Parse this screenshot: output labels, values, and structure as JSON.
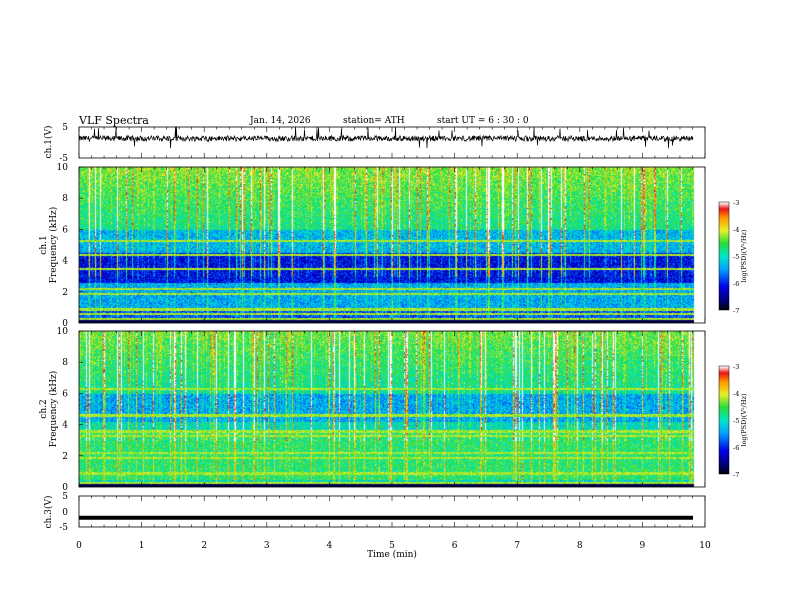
{
  "header": {
    "title": "VLF  Spectra",
    "date": "Jan. 14, 2026",
    "station": "station= ATH",
    "start_ut": "start  UT  =   6  : 30 : 0"
  },
  "chart_data": [
    {
      "type": "line",
      "panel": "ch1-waveform",
      "ylabel": "ch.1(V)",
      "ylim": [
        -5,
        5
      ],
      "yticks": [
        "5",
        "-5"
      ],
      "xlim": [
        0,
        10
      ],
      "baseline_v": 1.3
    },
    {
      "type": "heatmap",
      "panel": "ch1-spectrogram",
      "ylabel": "Frequency  (kHz)",
      "ylabel2": "ch.1",
      "ylim": [
        0,
        10
      ],
      "yticks": [
        "0",
        "2",
        "4",
        "6",
        "8",
        "10"
      ],
      "xlim": [
        0,
        10
      ],
      "colorbar": {
        "label": "log(PSD)(V²/Hz)",
        "range": [
          -7,
          -3
        ],
        "ticks": [
          "-3",
          "-4",
          "-5",
          "-6",
          "-7"
        ]
      },
      "noise_lines_khz": [
        0.3,
        0.6,
        0.9,
        1.9,
        2.2,
        3.5,
        4.4,
        5.3
      ]
    },
    {
      "type": "heatmap",
      "panel": "ch2-spectrogram",
      "ylabel": "Frequency  (kHz)",
      "ylabel2": "ch.2",
      "ylim": [
        0,
        10
      ],
      "yticks": [
        "0",
        "2",
        "4",
        "6",
        "8",
        "10"
      ],
      "xlim": [
        0,
        10
      ],
      "colorbar": {
        "label": "log(PSD)(V²/Hz)",
        "range": [
          -7,
          -3
        ],
        "ticks": [
          "-3",
          "-4",
          "-5",
          "-6",
          "-7"
        ]
      },
      "noise_lines_khz": [
        0.3,
        0.9,
        1.9,
        2.2,
        3.3,
        3.6,
        4.6,
        6.3
      ]
    },
    {
      "type": "line",
      "panel": "ch3-waveform",
      "ylabel": "ch.3(V)",
      "ylim": [
        -5,
        5
      ],
      "yticks": [
        "5",
        "0",
        "-5"
      ],
      "xlim": [
        0,
        10
      ],
      "xlabel": "Time  (min)",
      "xticks": [
        "0",
        "1",
        "2",
        "3",
        "4",
        "5",
        "6",
        "7",
        "8",
        "9",
        "10"
      ],
      "value_v": -2
    }
  ]
}
